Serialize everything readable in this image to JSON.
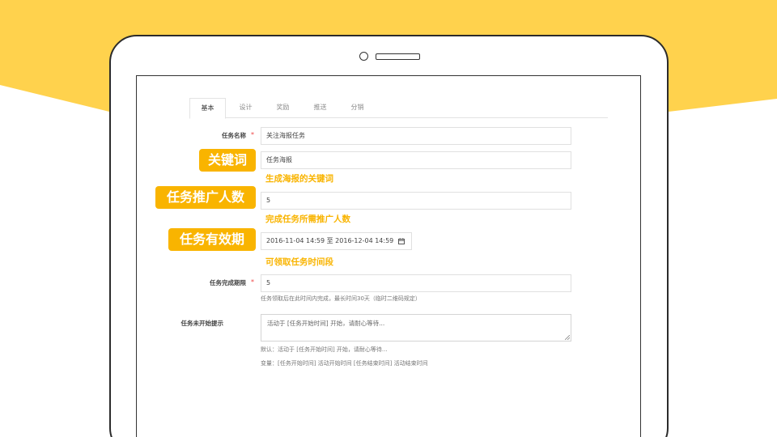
{
  "colors": {
    "accent": "#f9b400",
    "background_shape": "#ffd24d"
  },
  "tabs": [
    {
      "label": "基本",
      "active": true
    },
    {
      "label": "设计",
      "active": false
    },
    {
      "label": "奖励",
      "active": false
    },
    {
      "label": "推送",
      "active": false
    },
    {
      "label": "分销",
      "active": false
    }
  ],
  "form": {
    "task_name": {
      "label": "任务名称",
      "required_mark": "*",
      "value": "关注海报任务"
    },
    "keyword": {
      "value": "任务海报"
    },
    "promote_count": {
      "value": "5"
    },
    "validity": {
      "value": "2016-11-04 14:59 至 2016-12-04 14:59",
      "icon": "calendar-icon"
    },
    "completion_period": {
      "label": "任务完成期限",
      "required_mark": "*",
      "value": "5",
      "hint": "任务领取后在此时间内完成，最长时间30天（临时二维码规定）"
    },
    "not_started_tip": {
      "label": "任务未开始提示",
      "placeholder": "活动于 [任务开始时间] 开始，请耐心等待...",
      "default_hint": "默认：活动于 [任务开始时间] 开始，请耐心等待...",
      "variables_hint": "变量：[任务开始时间] 活动开始时间 [任务结束时间] 活动结束时间"
    }
  },
  "annotations": {
    "keyword_badge": "关键词",
    "keyword_hint": "生成海报的关键词",
    "promote_badge": "任务推广人数",
    "promote_hint": "完成任务所需推广人数",
    "validity_badge": "任务有效期",
    "validity_hint": "可领取任务时间段"
  }
}
